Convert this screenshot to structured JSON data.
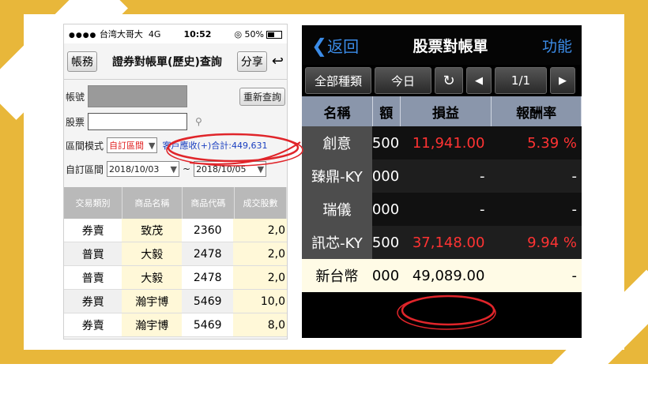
{
  "status_bar": {
    "carrier": "台湾大哥大",
    "network": "4G",
    "time": "10:52",
    "battery": "50%"
  },
  "left": {
    "menu_button": "帳務",
    "title": "證券對帳單(歷史)查詢",
    "share_button": "分享",
    "back_icon": "back-arrow-icon",
    "account_label": "帳號",
    "requery_button": "重新查詢",
    "stock_label": "股票",
    "stock_value": "",
    "range_mode_label": "區間模式",
    "range_mode_value": "自訂區間",
    "receivable_text": "客戶應收(+)合計:449,631",
    "custom_range_label": "自訂區間",
    "date_from": "2018/10/03",
    "date_sep": "~",
    "date_to": "2018/10/05",
    "columns": [
      "交易類別",
      "商品名稱",
      "商品代碼",
      "成交股數"
    ],
    "rows": [
      {
        "type": "券賣",
        "name": "致茂",
        "code": "2360",
        "qty": "2,0"
      },
      {
        "type": "普買",
        "name": "大毅",
        "code": "2478",
        "qty": "2,0"
      },
      {
        "type": "普賣",
        "name": "大毅",
        "code": "2478",
        "qty": "2,0"
      },
      {
        "type": "券買",
        "name": "瀚宇博",
        "code": "5469",
        "qty": "10,0"
      },
      {
        "type": "券賣",
        "name": "瀚宇博",
        "code": "5469",
        "qty": "8,0"
      }
    ]
  },
  "right": {
    "back_label": "返回",
    "title": "股票對帳單",
    "function_label": "功能",
    "filter_button": "全部種類",
    "today_button": "今日",
    "page_indicator": "1/1",
    "columns": [
      "名稱",
      "額",
      "損益",
      "報酬率"
    ],
    "rows": [
      {
        "name": "創意",
        "qty": "500",
        "pnl": "11,941.00",
        "ret": "5.39 %",
        "color": "red"
      },
      {
        "name": "臻鼎-KY",
        "qty": "000",
        "pnl": "-",
        "ret": "-",
        "color": "white"
      },
      {
        "name": "瑞儀",
        "qty": "000",
        "pnl": "-",
        "ret": "-",
        "color": "white"
      },
      {
        "name": "訊芯-KY",
        "qty": "500",
        "pnl": "37,148.00",
        "ret": "9.94 %",
        "color": "red"
      }
    ],
    "total": {
      "name": "新台幣",
      "qty": "000",
      "pnl": "49,089.00",
      "ret": "-"
    }
  },
  "colors": {
    "frame": "#e8b73a",
    "accent_blue": "#3b8ce8",
    "red": "#ff3333",
    "annotation": "#e0252a"
  }
}
